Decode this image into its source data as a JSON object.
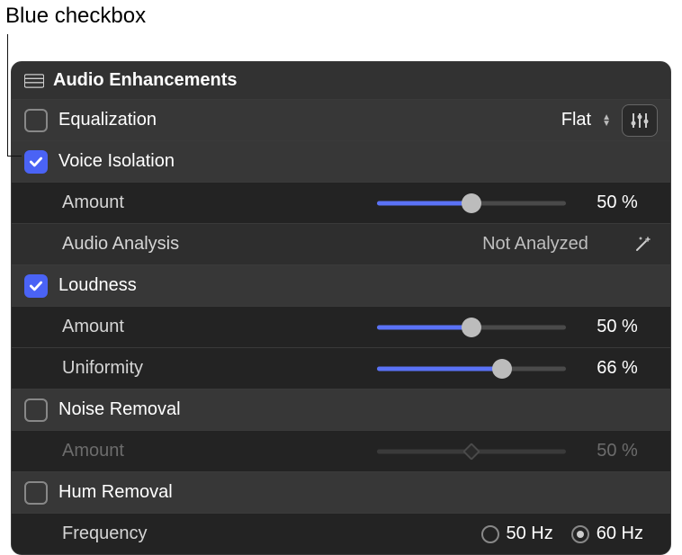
{
  "callout": {
    "text": "Blue checkbox"
  },
  "section": {
    "title": "Audio Enhancements"
  },
  "equalization": {
    "label": "Equalization",
    "checked": false,
    "preset": "Flat"
  },
  "voice_isolation": {
    "label": "Voice Isolation",
    "checked": true,
    "amount": {
      "label": "Amount",
      "value": 50,
      "display": "50 %"
    },
    "analysis": {
      "label": "Audio Analysis",
      "status": "Not Analyzed"
    }
  },
  "loudness": {
    "label": "Loudness",
    "checked": true,
    "amount": {
      "label": "Amount",
      "value": 50,
      "display": "50 %"
    },
    "uniformity": {
      "label": "Uniformity",
      "value": 66,
      "display": "66 %"
    }
  },
  "noise_removal": {
    "label": "Noise Removal",
    "checked": false,
    "amount": {
      "label": "Amount",
      "value": 50,
      "display": "50 %"
    }
  },
  "hum_removal": {
    "label": "Hum Removal",
    "checked": false,
    "frequency": {
      "label": "Frequency",
      "options": {
        "a": "50 Hz",
        "b": "60 Hz"
      },
      "selected": "b"
    }
  }
}
